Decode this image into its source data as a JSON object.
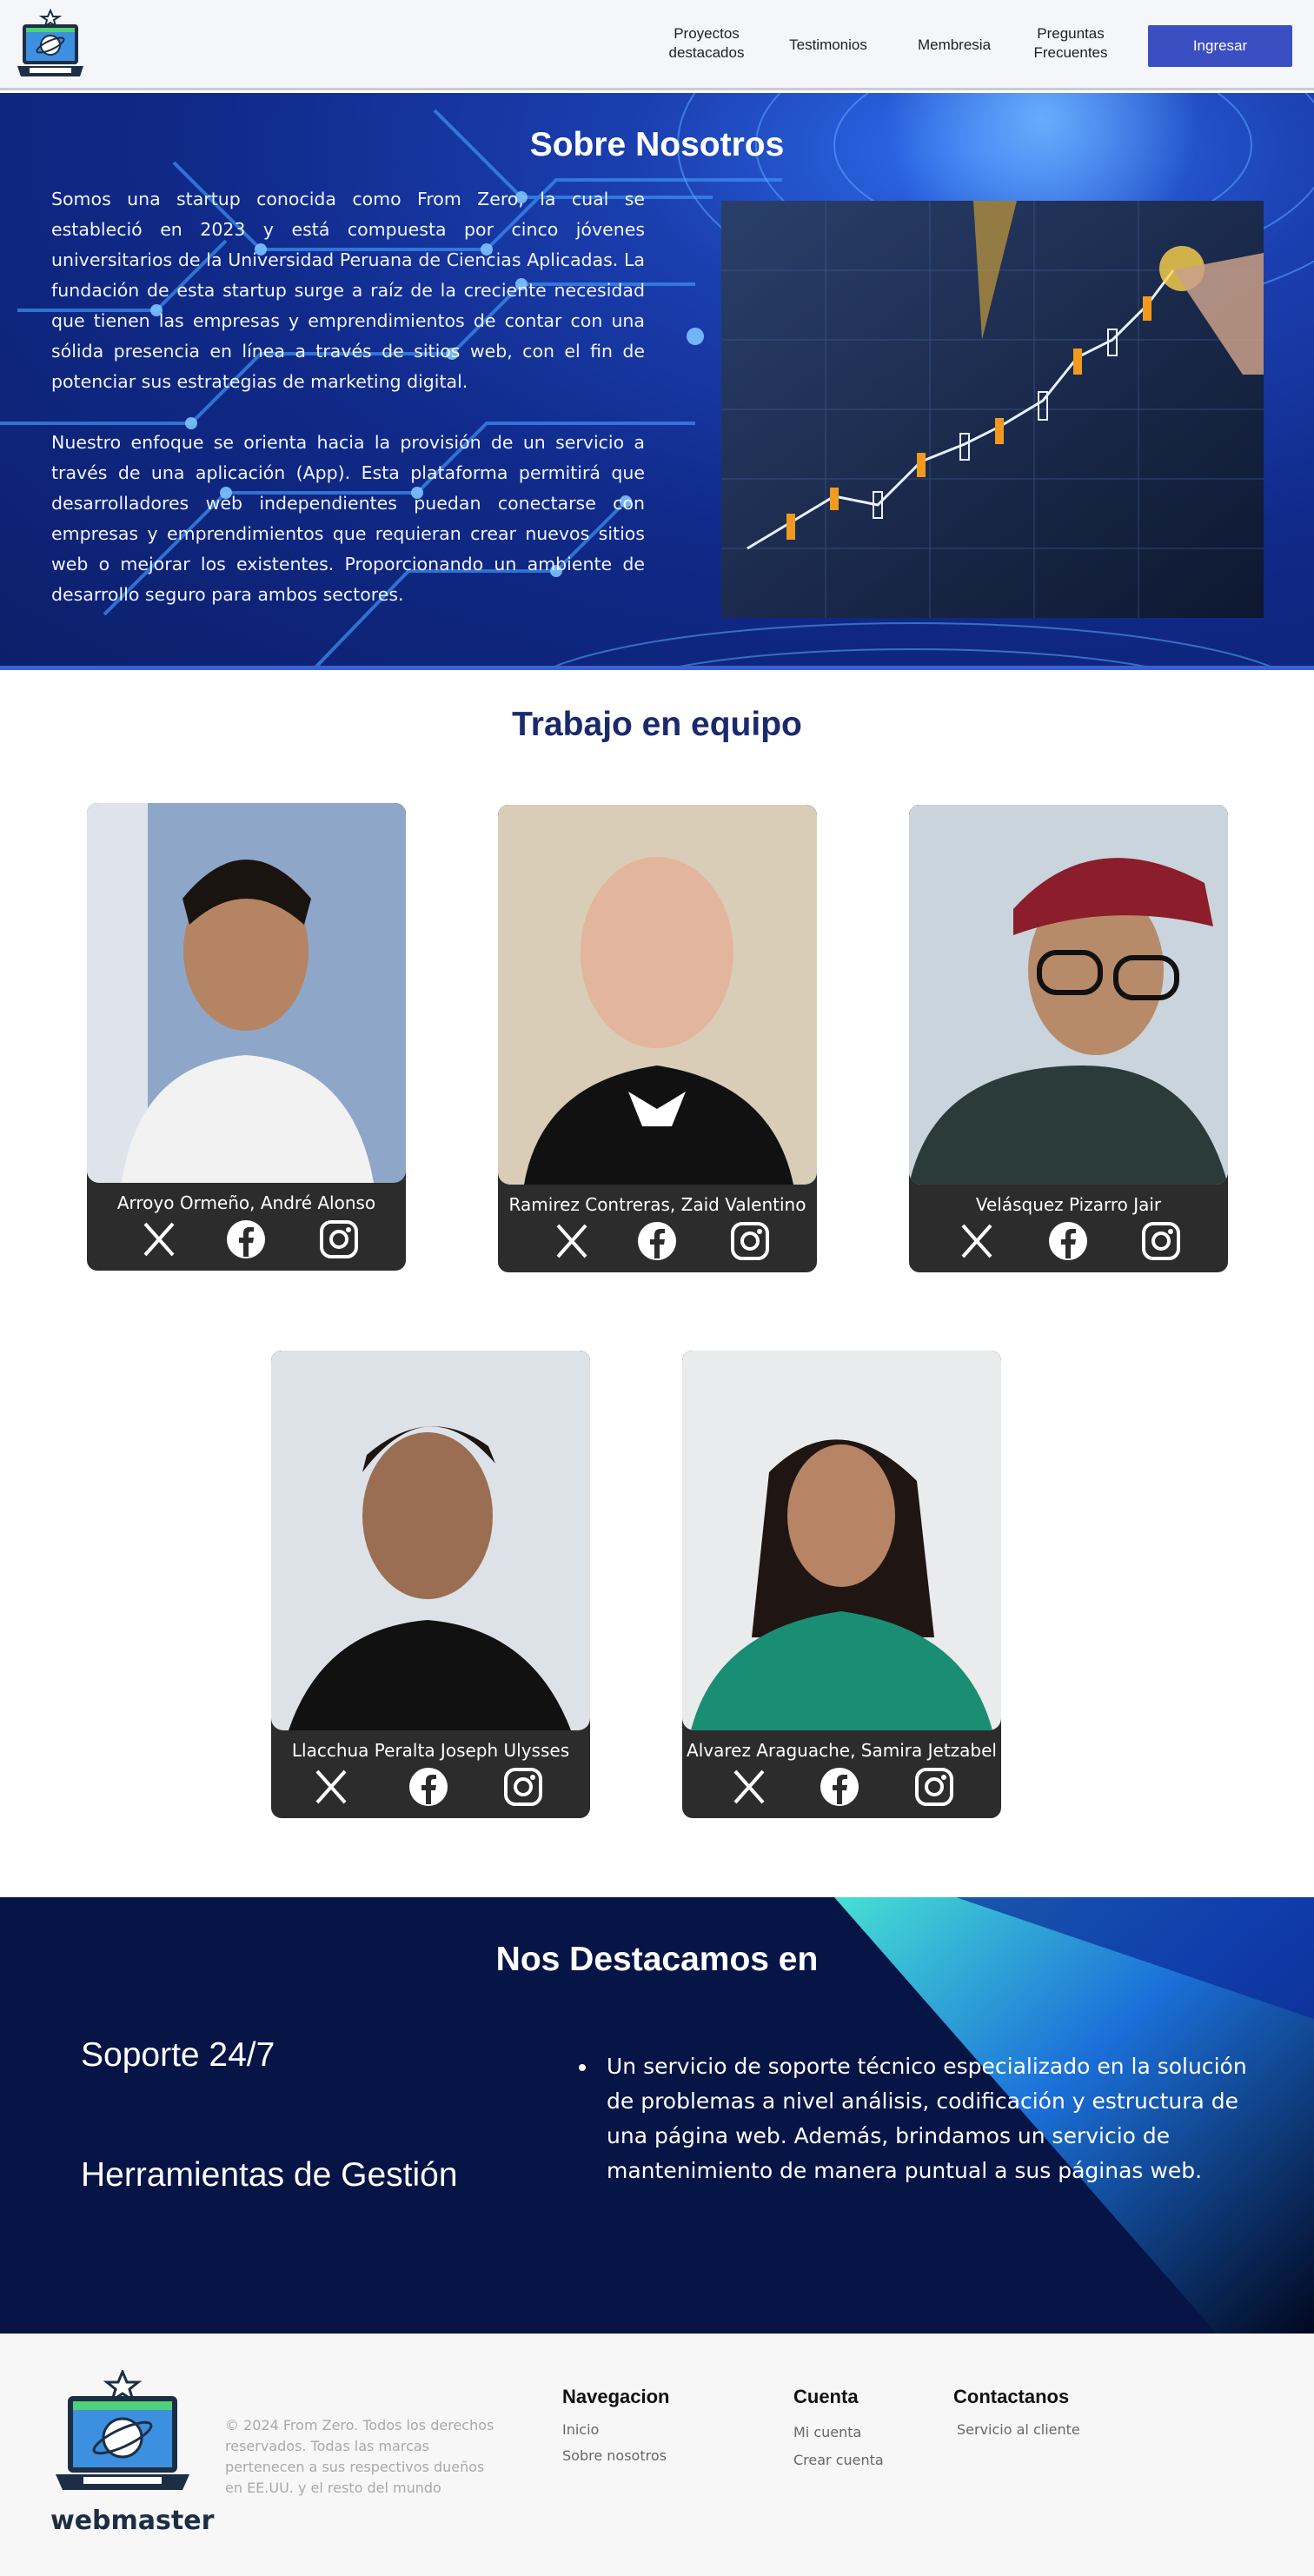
{
  "nav": {
    "links": [
      "Proyectos destacados",
      "Testimonios",
      "Membresia",
      "Preguntas Frecuentes"
    ],
    "login_button": "Ingresar"
  },
  "about": {
    "title": "Sobre Nosotros",
    "paragraph1": "Somos una startup conocida como From Zero, la cual se estableció en 2023 y está compuesta por cinco jóvenes universitarios de la Universidad Peruana de Ciencias Aplicadas. La fundación de esta startup surge a raíz de la creciente necesidad que tienen las empresas y emprendimientos de contar con una sólida presencia en línea a través de sitios web, con el fin de potenciar sus estrategias de marketing digital.",
    "paragraph2": "Nuestro enfoque se orienta hacia la provisión de un servicio a través de una aplicación (App). Esta plataforma permitirá que desarrolladores web independientes puedan conectarse con empresas y emprendimientos que requieran crear nuevos sitios web o mejorar los existentes. Proporcionando un ambiente de desarrollo seguro para ambos sectores."
  },
  "team": {
    "title": "Trabajo en equipo",
    "members": [
      {
        "name": "Arroyo Ormeño, André Alonso"
      },
      {
        "name": "Ramirez Contreras, Zaid Valentino"
      },
      {
        "name": "Velásquez Pizarro Jair"
      },
      {
        "name": "Llacchua Peralta Joseph Ulysses"
      },
      {
        "name": "Alvarez Araguache, Samira Jetzabel"
      }
    ]
  },
  "highlights": {
    "title": "Nos Destacamos en",
    "items": [
      "Soporte 24/7",
      "Herramientas de Gestión"
    ],
    "description": "Un servicio de soporte técnico especializado en la solución de problemas a nivel análisis, codificación y estructura de una página web. Además, brindamos un servicio de mantenimiento de manera puntual a sus páginas web."
  },
  "footer": {
    "brand": "webmaster",
    "copyright": "© 2024 From Zero. Todos los derechos reservados. Todas las marcas pertenecen a sus respectivos dueños en EE.UU. y el resto del mundo",
    "columns": [
      {
        "heading": "Navegacion",
        "links": [
          "Inicio",
          "Sobre nosotros"
        ]
      },
      {
        "heading": "Cuenta",
        "links": [
          "Mi cuenta",
          "Crear cuenta"
        ]
      },
      {
        "heading": "Contactanos",
        "links": [
          "Servicio al cliente"
        ]
      }
    ]
  },
  "colors": {
    "nav_bg": "#f4f6fa",
    "button": "#3b4fc2",
    "about_bg": "#102a8a",
    "team_title": "#1a2a6e",
    "card_bg": "#2c2c2c",
    "highlights_bg": "#061446",
    "footer_bg": "#f7f7f7"
  },
  "icons": [
    "laptop-logo-icon",
    "x-twitter-icon",
    "facebook-icon",
    "instagram-icon"
  ]
}
